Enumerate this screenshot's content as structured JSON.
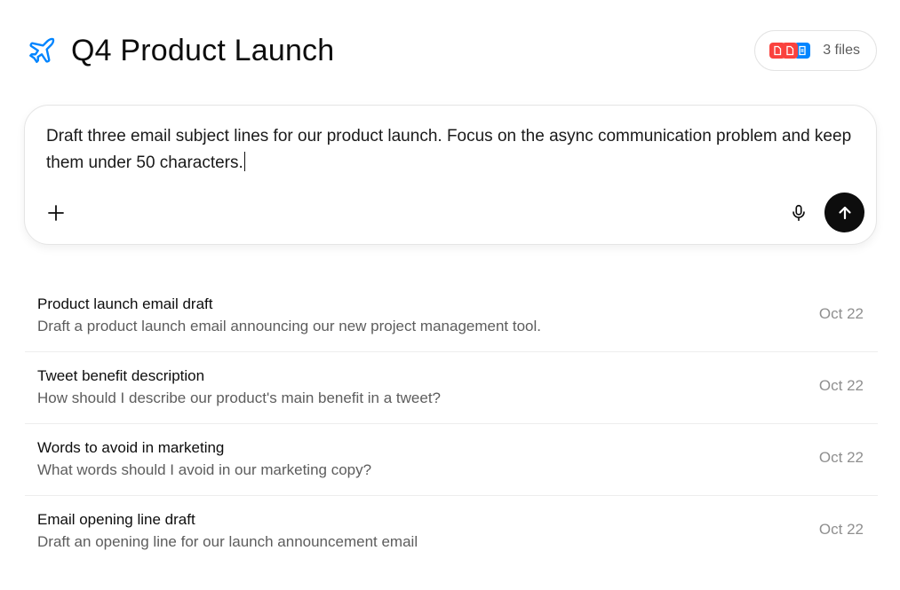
{
  "header": {
    "title": "Q4 Product Launch",
    "project_icon": "airplane-icon",
    "files_label": "3 files",
    "file_icons": [
      "pdf-icon",
      "pdf-icon",
      "doc-icon"
    ]
  },
  "composer": {
    "text": "Draft three email subject lines for our product launch. Focus on the async communication problem and keep them under 50 characters.",
    "add_icon": "plus-icon",
    "mic_icon": "microphone-icon",
    "send_icon": "arrow-up-icon"
  },
  "conversations": [
    {
      "title": "Product launch email draft",
      "snippet": "Draft a product launch email announcing our new project management tool.",
      "date": "Oct 22"
    },
    {
      "title": "Tweet benefit description",
      "snippet": "How should I describe our product's main benefit in a tweet?",
      "date": "Oct 22"
    },
    {
      "title": "Words to avoid in marketing",
      "snippet": "What words should I avoid in our marketing copy?",
      "date": "Oct 22"
    },
    {
      "title": "Email opening line draft",
      "snippet": "Draft an opening line for our launch announcement email",
      "date": "Oct 22"
    }
  ],
  "colors": {
    "project_icon": "#0285ff",
    "pdf_chip": "#fa423e",
    "doc_chip": "#0285ff",
    "send_button": "#0d0d0d"
  }
}
